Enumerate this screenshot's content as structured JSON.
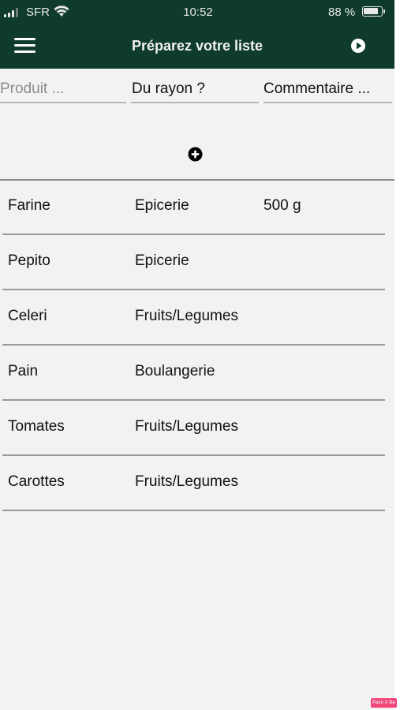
{
  "status_bar": {
    "carrier": "SFR",
    "time": "10:52",
    "battery_percent": "88 %",
    "battery_level": 0.88
  },
  "navbar": {
    "title": "Préparez votre liste",
    "icons": {
      "menu": "hamburger-menu-icon",
      "play": "play-circle-icon"
    }
  },
  "inputs": {
    "product": {
      "placeholder": "Produit ...",
      "value": ""
    },
    "aisle": {
      "placeholder": "Du rayon ?",
      "value": ""
    },
    "comment": {
      "placeholder": "Commentaire ...",
      "value": ""
    }
  },
  "add_button": {
    "icon": "plus-circle-icon"
  },
  "items": [
    {
      "product": "Farine",
      "aisle": "Epicerie",
      "comment": "500 g"
    },
    {
      "product": "Pepito",
      "aisle": "Epicerie",
      "comment": ""
    },
    {
      "product": "Celeri",
      "aisle": "Fruits/Legumes",
      "comment": ""
    },
    {
      "product": "Pain",
      "aisle": "Boulangerie",
      "comment": ""
    },
    {
      "product": "Tomates",
      "aisle": "Fruits/Legumes",
      "comment": ""
    },
    {
      "product": "Carottes",
      "aisle": "Fruits/Legumes",
      "comment": ""
    }
  ],
  "colors": {
    "header_bg": "#0e3b2a",
    "page_bg": "#f2f2f2",
    "text": "#111111"
  }
}
